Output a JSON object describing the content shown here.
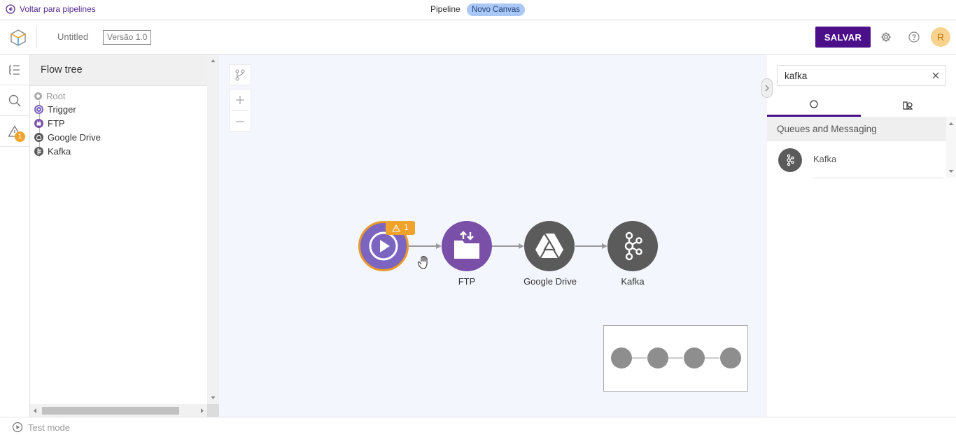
{
  "topbar": {
    "back_label": "Voltar para pipelines",
    "pipeline_label": "Pipeline",
    "canvas_badge": "Novo Canvas"
  },
  "header": {
    "title": "Untitled",
    "version": "Versão 1.0",
    "save_label": "SALVAR",
    "avatar_initial": "R",
    "accent": "#4b0f8a"
  },
  "rail": {
    "items": [
      "tree-list-icon",
      "search-icon",
      "warning-icon"
    ],
    "warning_count": "1"
  },
  "flow_tree": {
    "title": "Flow tree",
    "root": "Root",
    "nodes": [
      {
        "label": "Trigger",
        "icon": "play-icon",
        "color": "#7b65c0"
      },
      {
        "label": "FTP",
        "icon": "ftp-icon",
        "color": "#7a4fa8"
      },
      {
        "label": "Google Drive",
        "icon": "google-drive-icon",
        "color": "#5b5b5b"
      },
      {
        "label": "Kafka",
        "icon": "kafka-icon",
        "color": "#5b5b5b"
      }
    ]
  },
  "canvas": {
    "warning_count": "1",
    "nodes": [
      {
        "label": "",
        "icon": "play-icon",
        "color": "#7b65c0"
      },
      {
        "label": "FTP",
        "icon": "ftp-icon",
        "color": "#7a4fa8"
      },
      {
        "label": "Google Drive",
        "icon": "google-drive-icon",
        "color": "#5b5b5b"
      },
      {
        "label": "Kafka",
        "icon": "kafka-icon",
        "color": "#5b5b5b"
      }
    ]
  },
  "right_panel": {
    "search_value": "kafka",
    "tabs": [
      "circle-icon",
      "components-icon"
    ],
    "category": "Queues and Messaging",
    "results": [
      {
        "label": "Kafka",
        "icon": "kafka-icon"
      }
    ]
  },
  "footer": {
    "test_mode_label": "Test mode"
  }
}
